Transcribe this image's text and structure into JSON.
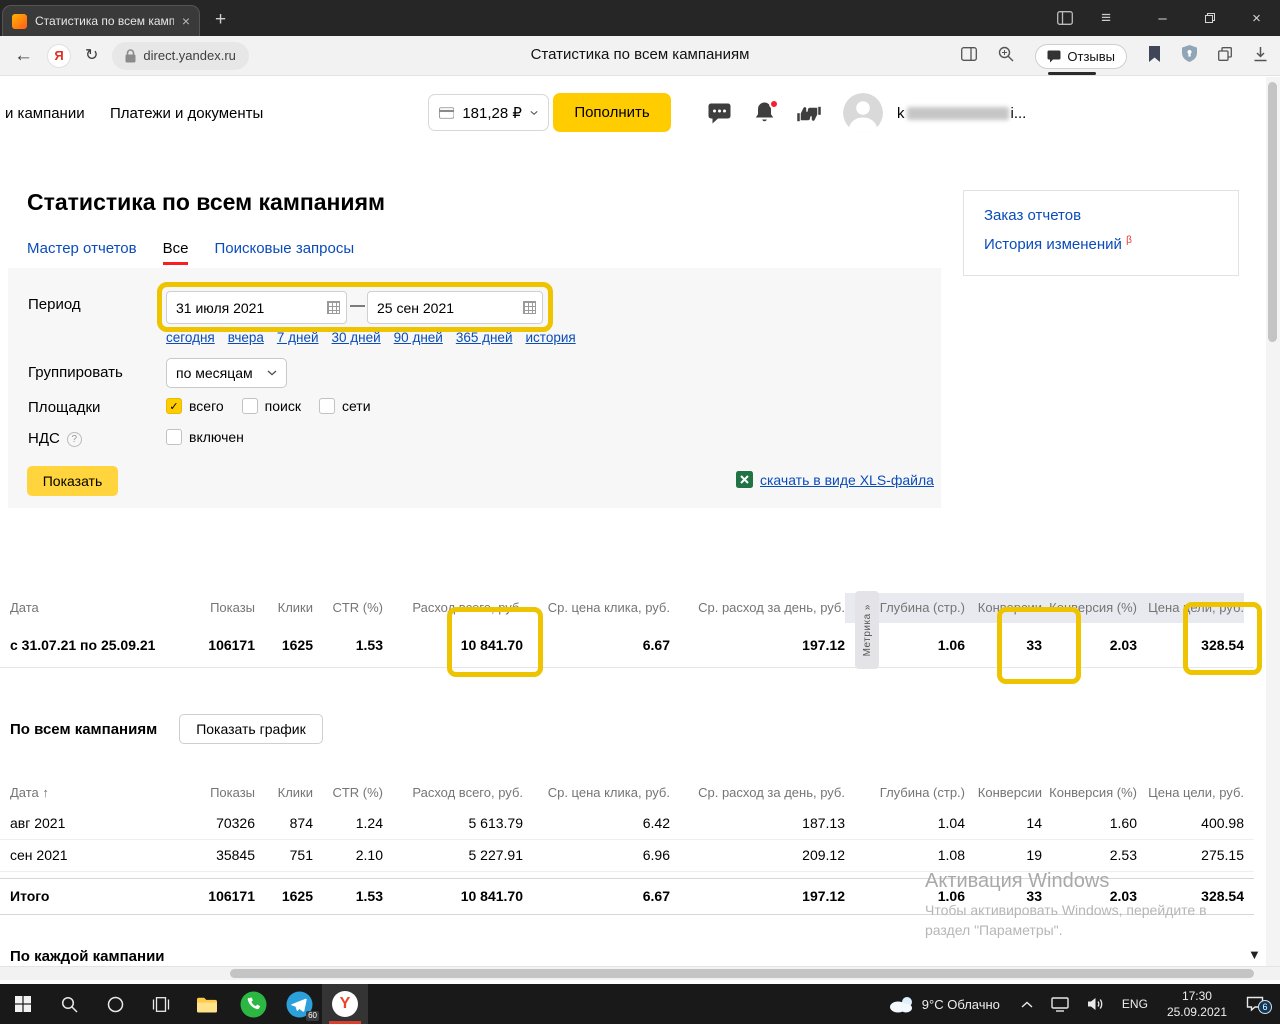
{
  "icons": {
    "close": "×",
    "new_tab": "+",
    "menu": "≡",
    "minimize": "–",
    "back": "←",
    "refresh": "↻",
    "check": "✓",
    "scroll_down": "▼"
  },
  "browser": {
    "tab_title": "Статистика по всем кампаниям",
    "url": "direct.yandex.ru",
    "page_title": "Статистика по всем кампаниям",
    "reviews_label": "Отзывы"
  },
  "topnav": {
    "nav_campaigns": "и кампании",
    "nav_payments": "Платежи и документы",
    "balance": "181,28 ₽",
    "topup": "Пополнить",
    "user_prefix": "k",
    "user_suffix": "i..."
  },
  "page": {
    "title": "Статистика по всем кампаниям",
    "tabs": {
      "master": "Мастер отчетов",
      "all": "Все",
      "search_queries": "Поисковые запросы"
    },
    "sidebar": {
      "order_reports": "Заказ отчетов",
      "change_history": "История изменений",
      "beta": "β"
    }
  },
  "filters": {
    "period_label": "Период",
    "date_from": "31 июля 2021",
    "date_sep": "—",
    "date_to": "25 сен 2021",
    "quick_links": [
      "сегодня",
      "вчера",
      "7 дней",
      "30 дней",
      "90 дней",
      "365 дней",
      "история"
    ],
    "group_label": "Группировать",
    "group_value": "по месяцам",
    "platforms_label": "Площадки",
    "platform_total": "всего",
    "platform_search": "поиск",
    "platform_networks": "сети",
    "vat_label": "НДС",
    "vat_help": "?",
    "vat_option": "включен",
    "show_button": "Показать",
    "xls_link": "скачать в виде XLS-файла"
  },
  "summary_table": {
    "metrika_label": "Метрика »",
    "headers": [
      "Дата",
      "Показы",
      "Клики",
      "CTR (%)",
      "Расход всего, руб.",
      "Ср. цена клика, руб.",
      "Ср. расход за день, руб.",
      "Глубина (стр.)",
      "Конверсии",
      "Конверсия (%)",
      "Цена цели, руб."
    ],
    "row": [
      "с 31.07.21 по 25.09.21",
      "106171",
      "1625",
      "1.53",
      "10 841.70",
      "6.67",
      "197.12",
      "1.06",
      "33",
      "2.03",
      "328.54"
    ]
  },
  "campaigns": {
    "title": "По всем кампаниям",
    "chart_button": "Показать график"
  },
  "monthly_table": {
    "headers": [
      "Дата ↑",
      "Показы",
      "Клики",
      "CTR (%)",
      "Расход всего, руб.",
      "Ср. цена клика, руб.",
      "Ср. расход за день, руб.",
      "Глубина (стр.)",
      "Конверсии",
      "Конверсия (%)",
      "Цена цели, руб."
    ],
    "rows": [
      [
        "авг 2021",
        "70326",
        "874",
        "1.24",
        "5 613.79",
        "6.42",
        "187.13",
        "1.04",
        "14",
        "1.60",
        "400.98"
      ],
      [
        "сен 2021",
        "35845",
        "751",
        "2.10",
        "5 227.91",
        "6.96",
        "209.12",
        "1.08",
        "19",
        "2.53",
        "275.15"
      ],
      [
        "Итого",
        "106171",
        "1625",
        "1.53",
        "10 841.70",
        "6.67",
        "197.12",
        "1.06",
        "33",
        "2.03",
        "328.54"
      ]
    ]
  },
  "next_section": "По каждой кампании",
  "watermark": {
    "line1": "Активация Windows",
    "line2": "Чтобы активировать Windows, перейдите в",
    "line3": "раздел \"Параметры\"."
  },
  "taskbar": {
    "weather": "9°C Облачно",
    "lang": "ENG",
    "time": "17:30",
    "date": "25.09.2021",
    "notif_badge": "6",
    "telegram_badge": "60"
  }
}
